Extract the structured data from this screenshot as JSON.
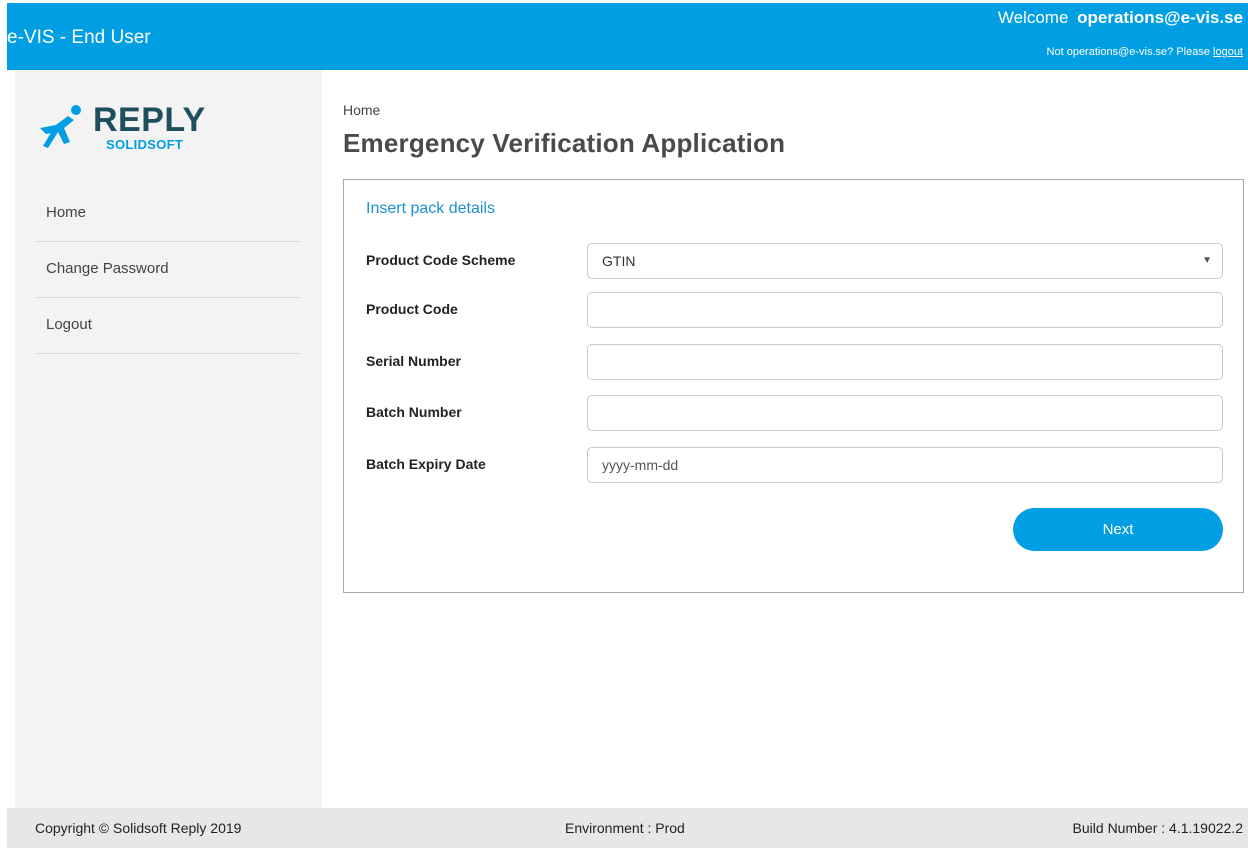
{
  "header": {
    "app_title": "e-VIS - End User",
    "welcome_label": "Welcome",
    "user_email": "operations@e-vis.se",
    "not_user_text": "Not operations@e-vis.se? Please",
    "logout_link": "logout",
    "background_color": "#009fe3"
  },
  "logo": {
    "wordmark": "REPLY",
    "subtitle": "SOLIDSOFT",
    "icon": "running-figure-logo-icon"
  },
  "sidebar": {
    "items": [
      {
        "label": "Home"
      },
      {
        "label": "Change Password"
      },
      {
        "label": "Logout"
      }
    ]
  },
  "main": {
    "breadcrumb": "Home",
    "title": "Emergency Verification Application"
  },
  "form": {
    "section_title": "Insert pack details",
    "product_code_scheme": {
      "label": "Product Code Scheme",
      "value": "GTIN",
      "icon": "dropdown-arrow-icon"
    },
    "product_code": {
      "label": "Product Code",
      "value": "",
      "placeholder": ""
    },
    "serial_number": {
      "label": "Serial Number",
      "value": "",
      "placeholder": ""
    },
    "batch_number": {
      "label": "Batch Number",
      "value": "",
      "placeholder": ""
    },
    "batch_expiry_date": {
      "label": "Batch Expiry Date",
      "value": "",
      "placeholder": "yyyy-mm-dd"
    },
    "next_button": "Next",
    "accent_color": "#009fe3"
  },
  "footer": {
    "copyright": "Copyright © Solidsoft Reply 2019",
    "environment": "Environment : Prod",
    "build": "Build Number : 4.1.19022.2"
  }
}
